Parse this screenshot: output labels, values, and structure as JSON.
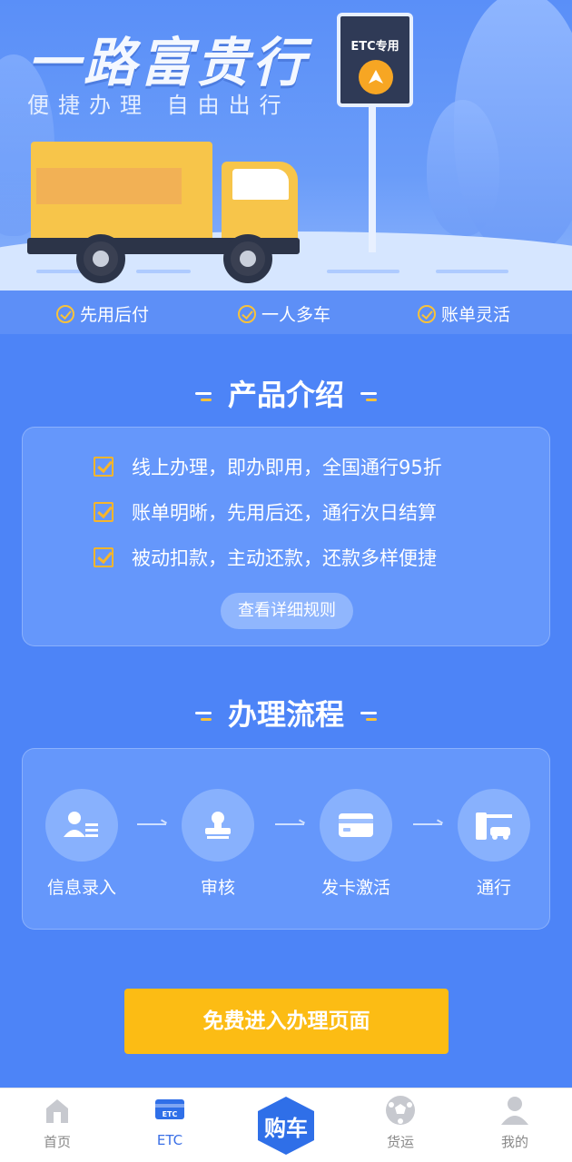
{
  "hero": {
    "title": "一路富贵行",
    "subtitle": "便捷办理 自由出行",
    "sign_text": "ETC专用"
  },
  "features": [
    {
      "label": "先用后付"
    },
    {
      "label": "一人多车"
    },
    {
      "label": "账单灵活"
    }
  ],
  "intro": {
    "title": "产品介绍",
    "items": [
      {
        "text": "线上办理，即办即用，全国通行95折"
      },
      {
        "text": "账单明晰，先用后还，通行次日结算"
      },
      {
        "text": "被动扣款，主动还款，还款多样便捷"
      }
    ],
    "rules_button": "查看详细规则"
  },
  "process": {
    "title": "办理流程",
    "steps": [
      {
        "label": "信息录入",
        "icon": "user-id-icon"
      },
      {
        "label": "审核",
        "icon": "stamp-icon"
      },
      {
        "label": "发卡激活",
        "icon": "card-icon"
      },
      {
        "label": "通行",
        "icon": "toll-gate-icon"
      }
    ]
  },
  "cta": {
    "label": "免费进入办理页面"
  },
  "nav": {
    "items": [
      {
        "label": "首页",
        "icon": "home-icon"
      },
      {
        "label": "ETC",
        "icon": "etc-card-icon"
      },
      {
        "label": "购车",
        "icon": "hexagon-buy-car-icon"
      },
      {
        "label": "货运",
        "icon": "freight-ball-icon"
      },
      {
        "label": "我的",
        "icon": "person-icon"
      }
    ],
    "active": "ETC"
  },
  "colors": {
    "background": "#4d84f7",
    "accent": "#fcbc14",
    "nav_active": "#3a6fe6"
  }
}
